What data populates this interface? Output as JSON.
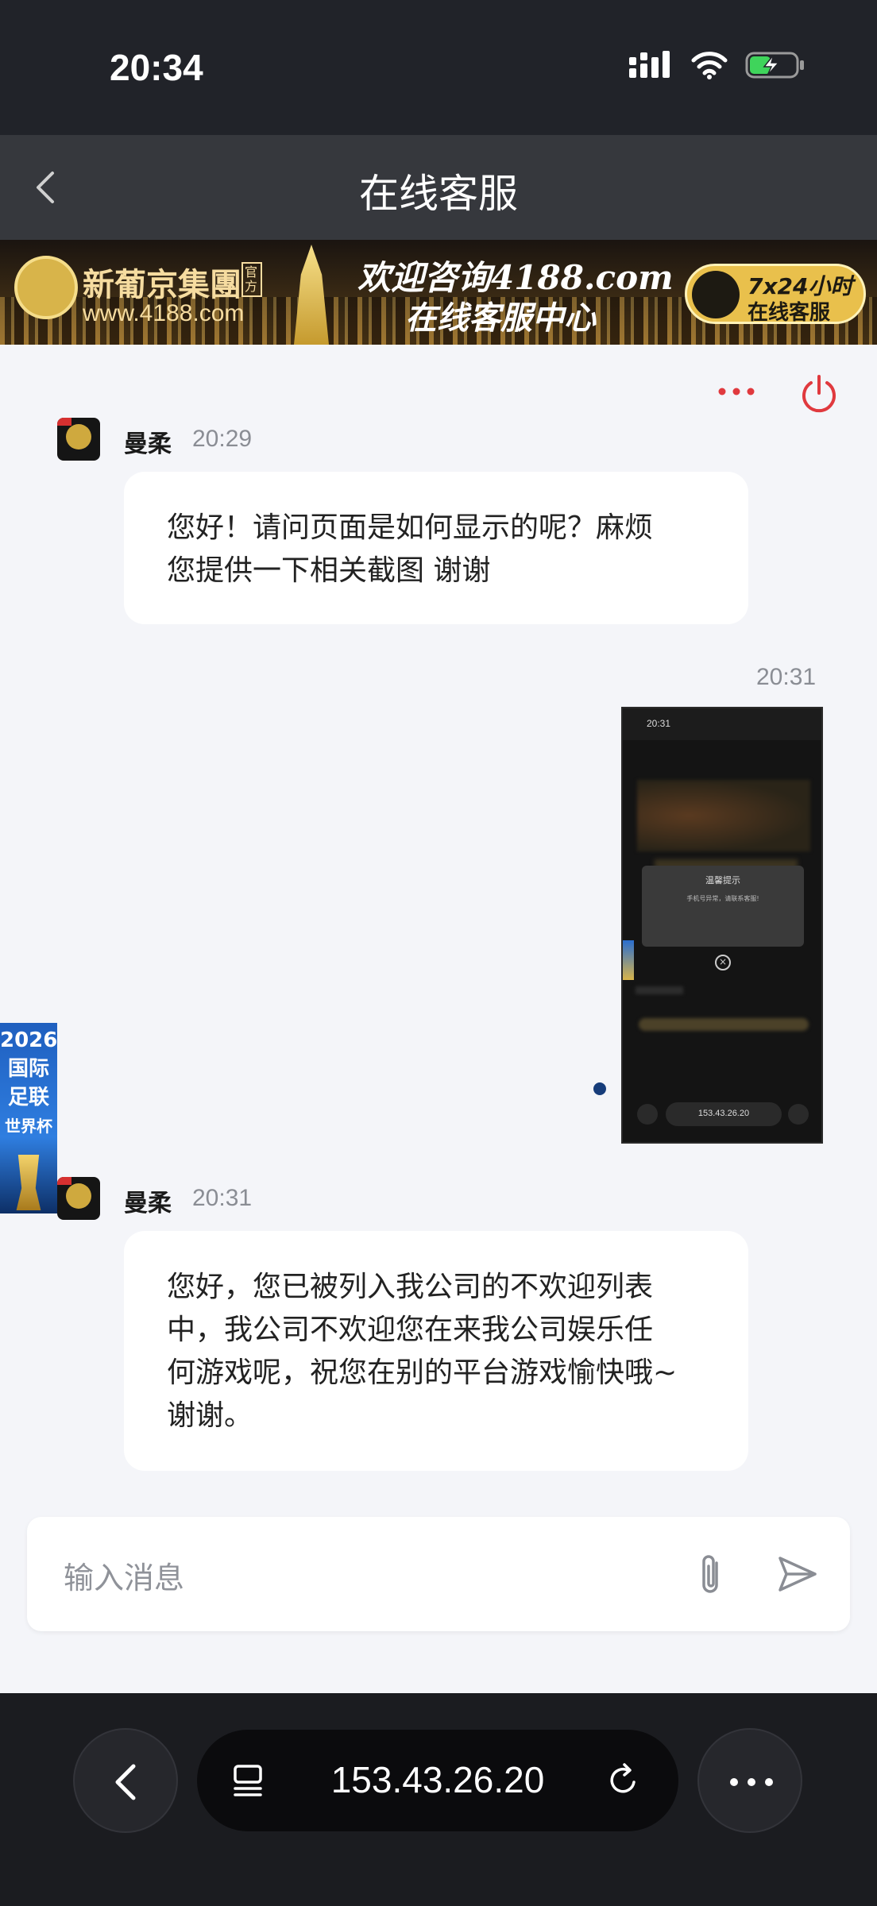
{
  "status_bar": {
    "time": "20:34"
  },
  "header": {
    "title": "在线客服"
  },
  "banner": {
    "brand": "新葡京集團",
    "official": "官方",
    "url": "www.4188.com",
    "welcome": "欢迎咨询4188.com",
    "center": "在线客服中心",
    "badge_line1": "7x24小时",
    "badge_line2": "在线客服"
  },
  "messages": [
    {
      "sender": "曼柔",
      "time": "20:29",
      "text_line1": "您好！请问页面是如何显示的呢？麻烦",
      "text_line2": "您提供一下相关截图 谢谢"
    },
    {
      "sender_time": "20:31"
    },
    {
      "sender": "曼柔",
      "time": "20:31",
      "text_line1": "您好，您已被列入我公司的不欢迎列表",
      "text_line2": "中，我公司不欢迎您在来我公司娱乐任",
      "text_line3": "何游戏呢，祝您在别的平台游戏愉快哦~",
      "text_line4": "谢谢。"
    }
  ],
  "screenshot_thumb": {
    "time": "20:31",
    "dialog_title": "温馨提示",
    "dialog_text": "手机号异常，请联系客服!",
    "url": "153.43.26.20"
  },
  "float_ad": {
    "line1": "2026",
    "line2": "国际",
    "line3": "足联",
    "line4": "世界杯"
  },
  "composer": {
    "placeholder": "输入消息"
  },
  "browser": {
    "url": "153.43.26.20"
  },
  "colors": {
    "accent_red": "#e0393e",
    "nav_bg": "#36383d",
    "status_bg": "#212329",
    "dot_blue": "#163c7a"
  }
}
